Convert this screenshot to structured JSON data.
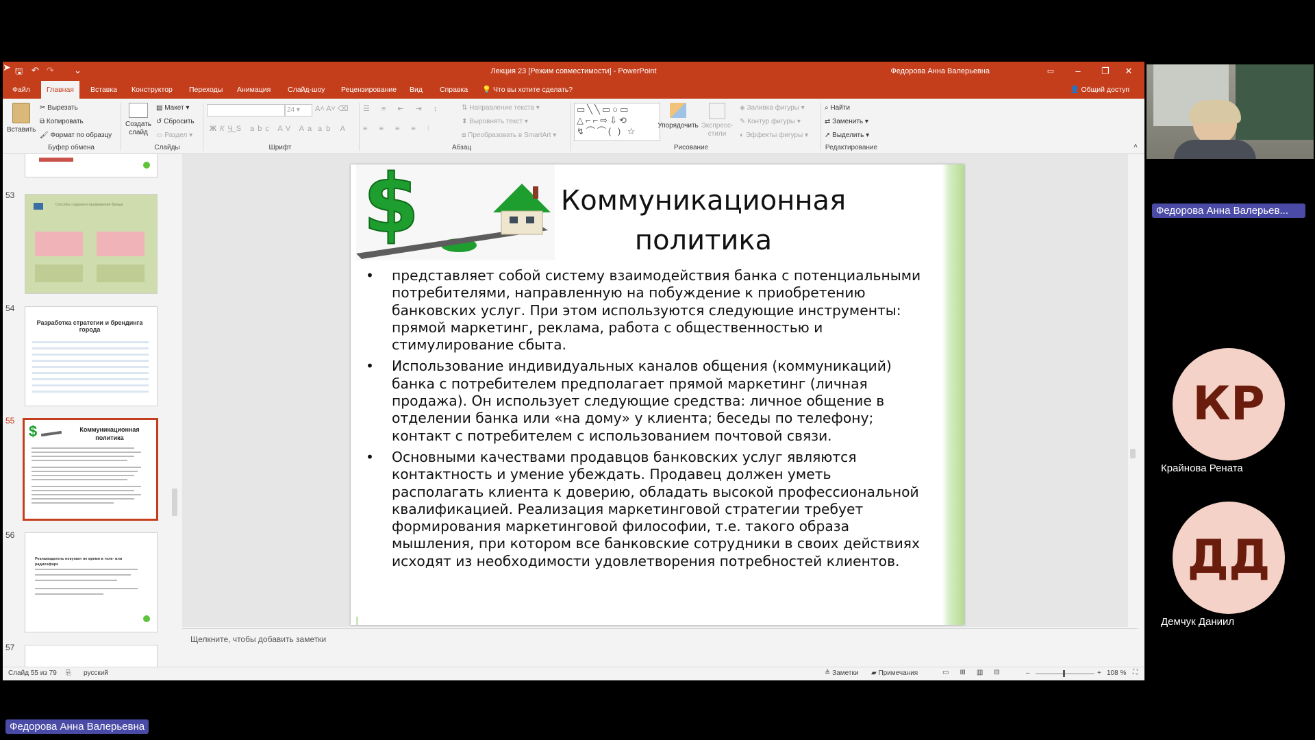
{
  "window": {
    "title": "Лекция 23 [Режим совместимости]  -  PowerPoint",
    "user": "Федорова Анна Валерьевна",
    "share_label": "Общий доступ"
  },
  "tabs": [
    {
      "label": "Файл"
    },
    {
      "label": "Главная"
    },
    {
      "label": "Вставка"
    },
    {
      "label": "Конструктор"
    },
    {
      "label": "Переходы"
    },
    {
      "label": "Анимация"
    },
    {
      "label": "Слайд-шоу"
    },
    {
      "label": "Рецензирование"
    },
    {
      "label": "Вид"
    },
    {
      "label": "Справка"
    }
  ],
  "tell_me": "Что вы хотите сделать?",
  "ribbon": {
    "paste": "Вставить",
    "cut": "Вырезать",
    "copy": "Копировать",
    "format_painter": "Формат по образцу",
    "clipboard_group": "Буфер обмена",
    "new_slide": "Создать слайд",
    "layout": "Макет",
    "reset": "Сбросить",
    "section": "Раздел",
    "slides_group": "Слайды",
    "font_size": "24",
    "font_group": "Шрифт",
    "text_direction": "Направление текста",
    "align_text": "Выровнять текст",
    "convert_smartart": "Преобразовать в SmartArt",
    "paragraph_group": "Абзац",
    "arrange": "Упорядочить",
    "quick_styles": "Экспресс-стили",
    "shape_fill": "Заливка фигуры",
    "shape_outline": "Контур фигуры",
    "shape_effects": "Эффекты фигуры",
    "drawing_group": "Рисование",
    "find": "Найти",
    "replace": "Заменить",
    "select": "Выделить",
    "editing_group": "Редактирование"
  },
  "thumbnails": [
    {
      "num": "53",
      "title": "Способы создания и продвижения бренда"
    },
    {
      "num": "54",
      "title": "Разработка стратегии и брендинга города"
    },
    {
      "num": "55",
      "title": "Коммуникационная политика"
    },
    {
      "num": "56",
      "title": "Рекламодатель покупает не время в теле- или радиоэфире"
    },
    {
      "num": "57",
      "title": ""
    }
  ],
  "slide": {
    "title": "Коммуникационная политика",
    "bullets": [
      "представляет собой систему взаимодействия банка с потенциальными потребителями, направленную на побуждение к приобретению банковских услуг. При этом используются следующие инструменты: прямой маркетинг, реклама, работа с общественностью и стимулирование сбыта.",
      "Использование индивидуальных каналов общения (коммуникаций) банка с потребителем предполагает прямой маркетинг (личная продажа). Он использует следующие средства: личное общение в отделении банка или «на дому» у клиента; беседы по телефону; контакт с потребителем с использованием почтовой связи.",
      "Основными качествами продавцов банковских услуг являются контактность и умение убеждать. Продавец должен уметь располагать клиента к доверию, обладать высокой профессиональной квалификацией. Реализация маркетинговой стратегии требует формирования маркетинговой философии, т.е. такого образа мышления, при котором все банковские сотрудники в своих действиях исходят из необходимости удовлетворения потребностей клиентов."
    ]
  },
  "notes_placeholder": "Щелкните, чтобы добавить заметки",
  "status": {
    "slide_counter": "Слайд 55 из 79",
    "language": "русский",
    "notes": "Заметки",
    "comments": "Примечания",
    "zoom": "108 %"
  },
  "participants": {
    "presenter_tile": "Федорова Анна Валерьев...",
    "presenter_full": "Федорова Анна Валерьевна",
    "others": [
      {
        "initials": "КР",
        "name": "Крайнова Рената"
      },
      {
        "initials": "ДД",
        "name": "Демчук Даниил"
      }
    ]
  },
  "colors": {
    "ppt_accent": "#c43e1c",
    "nameplate": "#4a4ba6",
    "avatar_bg": "#f4d2c7",
    "slide_green": "#1e9e2e"
  }
}
